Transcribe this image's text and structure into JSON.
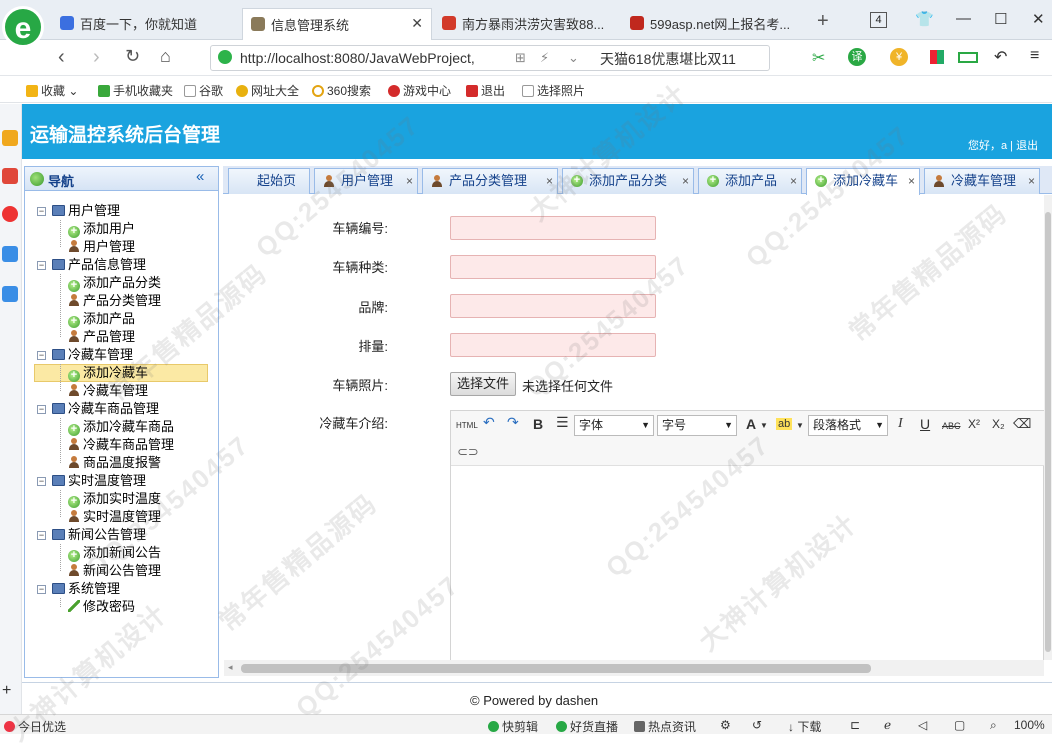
{
  "browser": {
    "tabs": [
      {
        "label": "百度一下，你就知道",
        "active": false
      },
      {
        "label": "信息管理系统",
        "active": true
      },
      {
        "label": "南方暴雨洪涝灾害致88...",
        "active": false
      },
      {
        "label": "599asp.net网上报名考...",
        "active": false
      }
    ],
    "new_tab": "+",
    "tab_count": "4",
    "url": "http://localhost:8080/JavaWebProject,",
    "promo": "天猫618优惠堪比双11",
    "bookmarks": [
      "收藏",
      "手机收藏夹",
      "谷歌",
      "网址大全",
      "360搜索",
      "游戏中心",
      "退出",
      "选择照片"
    ],
    "status_left": "今日优选",
    "status_items": [
      "快剪辑",
      "好货直播",
      "热点资讯",
      "下载"
    ],
    "zoom": "100%"
  },
  "app": {
    "title": "运输温控系统后台管理",
    "greeting": "您好，a | 退出"
  },
  "nav": {
    "title": "导航",
    "collapse": "«",
    "tree": [
      {
        "label": "用户管理",
        "children": [
          "添加用户",
          "用户管理"
        ]
      },
      {
        "label": "产品信息管理",
        "children": [
          "添加产品分类",
          "产品分类管理",
          "添加产品",
          "产品管理"
        ]
      },
      {
        "label": "冷藏车管理",
        "children": [
          "添加冷藏车",
          "冷藏车管理"
        ]
      },
      {
        "label": "冷藏车商品管理",
        "children": [
          "添加冷藏车商品",
          "冷藏车商品管理",
          "商品温度报警"
        ]
      },
      {
        "label": "实时温度管理",
        "children": [
          "添加实时温度",
          "实时温度管理"
        ]
      },
      {
        "label": "新闻公告管理",
        "children": [
          "添加新闻公告",
          "新闻公告管理"
        ]
      },
      {
        "label": "系统管理",
        "children": [
          "修改密码"
        ]
      }
    ]
  },
  "content_tabs": [
    {
      "label": "起始页",
      "closable": false,
      "active": false
    },
    {
      "label": "用户管理",
      "closable": true,
      "active": false
    },
    {
      "label": "产品分类管理",
      "closable": true,
      "active": false
    },
    {
      "label": "添加产品分类",
      "closable": true,
      "active": false
    },
    {
      "label": "添加产品",
      "closable": true,
      "active": false
    },
    {
      "label": "添加冷藏车",
      "closable": true,
      "active": true
    },
    {
      "label": "冷藏车管理",
      "closable": true,
      "active": false
    }
  ],
  "form": {
    "labels": {
      "vehicle_no": "车辆编号:",
      "vehicle_type": "车辆种类:",
      "brand": "品牌:",
      "displacement": "排量:",
      "photo": "车辆照片:",
      "intro": "冷藏车介绍:"
    },
    "values": {
      "vehicle_no": "",
      "vehicle_type": "",
      "brand": "",
      "displacement": ""
    },
    "file_button": "选择文件",
    "file_status": "未选择任何文件",
    "editor": {
      "html": "HTML",
      "bold": "B",
      "font_family": "字体",
      "font_size": "字号",
      "font_color": "A",
      "paragraph": "段落格式",
      "italic": "I",
      "underline": "U",
      "strike": "ABC",
      "superscript": "X²",
      "subscript": "X₂"
    }
  },
  "footer": "© Powered by dashen",
  "watermarks": [
    "QQ:254540457",
    "常年售精品源码",
    "大神计算机设计"
  ]
}
